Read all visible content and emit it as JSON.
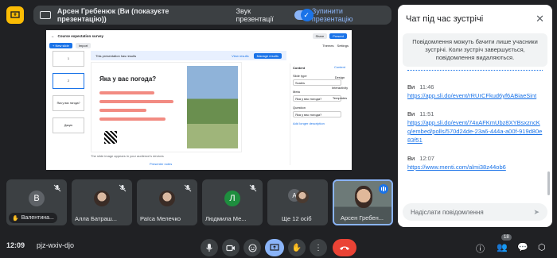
{
  "presenter": {
    "name": "Арсен Гребенюк (Ви (показуєте презентацію))",
    "sound_label": "Звук презентації",
    "stop_label": "Зупинити презентацію"
  },
  "slide": {
    "title": "Course expectation survey",
    "new_slide": "+ New slide",
    "import": "Import",
    "share": "Share",
    "present": "Present",
    "themes": "Themes",
    "settings": "Settings",
    "banner_text": "This presentation has results",
    "view_results": "View results",
    "manage_results": "Manage results",
    "question": "Яка у вас погода?",
    "note": "The slide image appears in your audience's devices",
    "presenter_notes": "Presenter notes",
    "thumbs": [
      "1",
      "2",
      "Яка у вас погода?",
      "Дякую"
    ],
    "panel": {
      "header": "Content",
      "slide_type": "Slide type",
      "type_value": "Scales",
      "meta": "Meta",
      "meta_value": "Яка у вас погода?",
      "question": "Question",
      "question_value": "Яка у вас погода?",
      "add_desc": "Add longer description"
    },
    "right_tools": [
      "Content",
      "Design",
      "Interactivity",
      "Templates"
    ]
  },
  "participants": [
    {
      "name": "Валентина...",
      "initial": "В",
      "color": "#5f6368",
      "muted": true
    },
    {
      "name": "Алла Батраш...",
      "initial": "",
      "color": "",
      "muted": true
    },
    {
      "name": "Раїса Мелечко",
      "initial": "",
      "color": "",
      "muted": true
    },
    {
      "name": "Людмила Ме...",
      "initial": "Л",
      "color": "#1e8e3e",
      "muted": true
    },
    {
      "name": "Ще 12 осіб",
      "initial": "",
      "color": "",
      "muted": false
    },
    {
      "name": "Арсен Гребен...",
      "initial": "",
      "color": "",
      "muted": false
    }
  ],
  "bottom": {
    "time": "12:09",
    "meeting_code": "pjz-wxiv-djo",
    "people_count": "18"
  },
  "chat": {
    "title": "Чат під час зустрічі",
    "notice": "Повідомлення можуть бачити лише учасники зустрічі. Коли зустріч завершується, повідомлення видаляються.",
    "messages": [
      {
        "who": "Ви",
        "time": "11:46",
        "text": "https://app.sli.do/event/rRUrCFkud6yf6ABiaeSint"
      },
      {
        "who": "Ви",
        "time": "11:51",
        "text": "https://app.sli.do/event/74xAFKmUbz8XYBsxzncKg/embed/polls/570d24de-23a6-444a-a00f-919d80e83f51"
      },
      {
        "who": "Ви",
        "time": "12:07",
        "text": "https://www.menti.com/almi38z44ob6"
      }
    ],
    "input_placeholder": "Надіслати повідомлення"
  }
}
